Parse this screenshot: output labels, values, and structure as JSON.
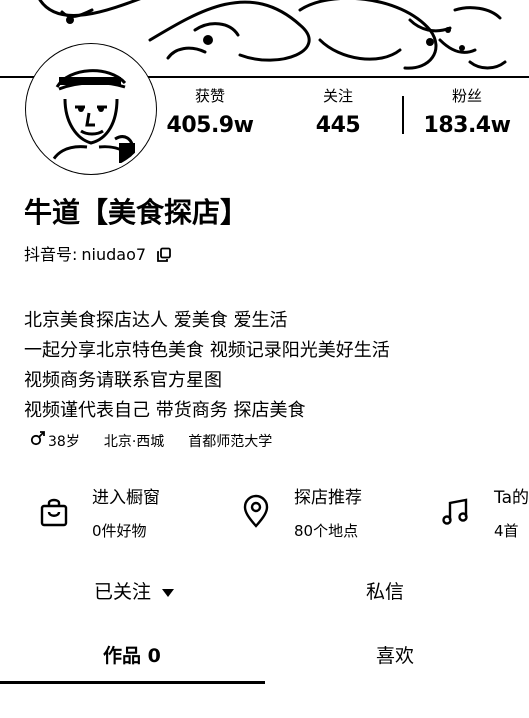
{
  "profile": {
    "name": "牛道【美食探店】",
    "account_label": "抖音号:",
    "account_id": "niudao7"
  },
  "stats": [
    {
      "label": "获赞",
      "value": "405.9w"
    },
    {
      "label": "关注",
      "value": "445"
    },
    {
      "label": "粉丝",
      "value": "183.4w"
    }
  ],
  "bio": [
    "北京美食探店达人 爱美食 爱生活",
    "一起分享北京特色美食 视频记录阳光美好生活",
    "视频商务请联系官方星图",
    "视频谨代表自己 带货商务 探店美食"
  ],
  "tags": {
    "age": "38岁",
    "location": "北京·西城",
    "school": "首都师范大学"
  },
  "entries": [
    {
      "title": "进入橱窗",
      "subtitle": "0件好物",
      "icon": "shopping-bag-icon"
    },
    {
      "title": "探店推荐",
      "subtitle": "80个地点",
      "icon": "location-pin-icon"
    },
    {
      "title": "Ta的",
      "subtitle": "4首",
      "icon": "music-note-icon"
    }
  ],
  "actions": {
    "followed": "已关注",
    "message": "私信"
  },
  "tabs": {
    "works": "作品 0",
    "likes": "喜欢"
  }
}
